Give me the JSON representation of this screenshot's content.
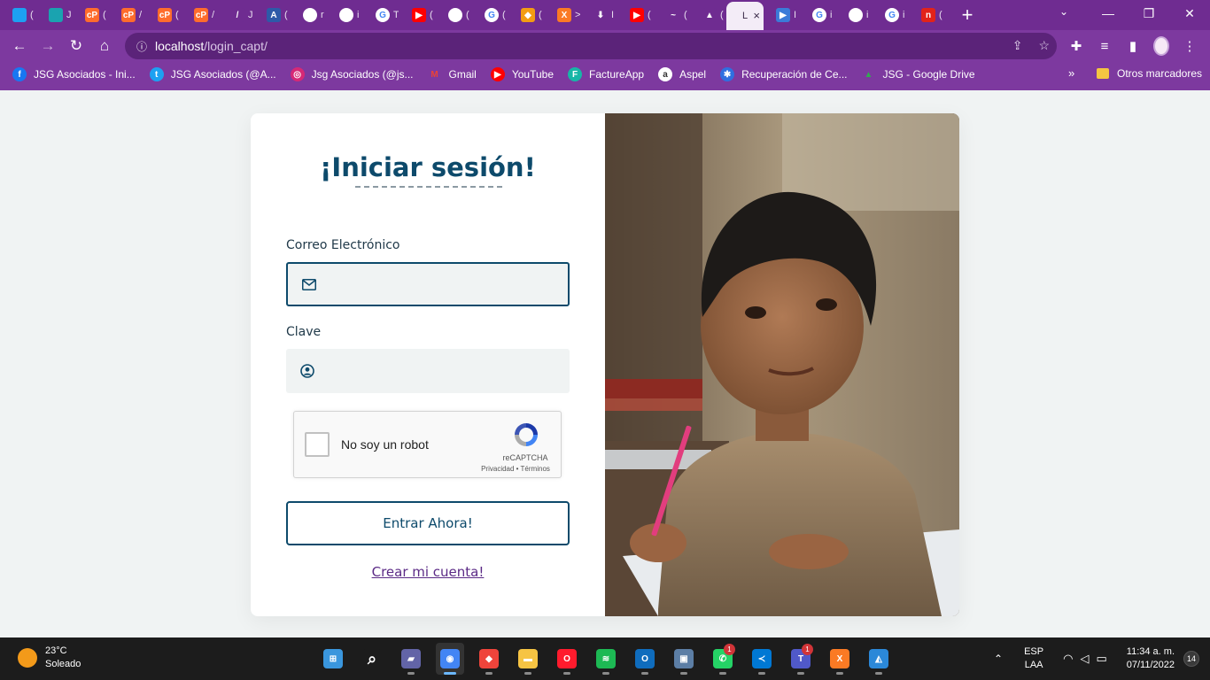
{
  "browser": {
    "tabs": [
      {
        "icon": "twitter-icon",
        "letter": "",
        "color": "#1da1f2",
        "title": "("
      },
      {
        "icon": "pulse-icon",
        "letter": "",
        "color": "#1aa3b0",
        "title": "J"
      },
      {
        "icon": "cpanel-icon",
        "letter": "cP",
        "color": "#ff6c2c",
        "title": "("
      },
      {
        "icon": "cpanel-icon",
        "letter": "cP",
        "color": "#ff6c2c",
        "title": "/"
      },
      {
        "icon": "cpanel-icon",
        "letter": "cP",
        "color": "#ff6c2c",
        "title": "("
      },
      {
        "icon": "cpanel-icon",
        "letter": "cP",
        "color": "#ff6c2c",
        "title": "/"
      },
      {
        "icon": "slash-icon",
        "letter": "/",
        "color": "#6f2c91",
        "title": "J"
      },
      {
        "icon": "document-icon",
        "letter": "A",
        "color": "#2d5aa8",
        "title": "("
      },
      {
        "icon": "globe-icon",
        "letter": "",
        "color": "#ffffff",
        "title": "r"
      },
      {
        "icon": "globe-icon",
        "letter": "",
        "color": "#ffffff",
        "title": "i"
      },
      {
        "icon": "google-icon",
        "letter": "G",
        "color": "#ffffff",
        "title": "T"
      },
      {
        "icon": "youtube-icon",
        "letter": "▶",
        "color": "#ff0000",
        "title": "("
      },
      {
        "icon": "github-icon",
        "letter": "",
        "color": "#ffffff",
        "title": "("
      },
      {
        "icon": "google-icon",
        "letter": "G",
        "color": "#ffffff",
        "title": "("
      },
      {
        "icon": "diamond-icon",
        "letter": "◆",
        "color": "#f39c12",
        "title": "("
      },
      {
        "icon": "xampp-icon",
        "letter": "X",
        "color": "#fb7a24",
        "title": ">"
      },
      {
        "icon": "download-icon",
        "letter": "⬇",
        "color": "#6f2c91",
        "title": "I"
      },
      {
        "icon": "youtube-icon",
        "letter": "▶",
        "color": "#ff0000",
        "title": "("
      },
      {
        "icon": "swoosh-icon",
        "letter": "~",
        "color": "#6f2c91",
        "title": "("
      },
      {
        "icon": "logo-icon",
        "letter": "▲",
        "color": "#6f2c91",
        "title": "("
      }
    ],
    "active_tab": {
      "title": "L",
      "close": "×"
    },
    "tabs_after": [
      {
        "icon": "app-icon",
        "letter": "▶",
        "color": "#3b7bd8",
        "title": "I"
      },
      {
        "icon": "google-icon",
        "letter": "G",
        "color": "#ffffff",
        "title": "i"
      },
      {
        "icon": "globe-icon",
        "letter": "",
        "color": "#ffffff",
        "title": "i"
      },
      {
        "icon": "google-icon",
        "letter": "G",
        "color": "#ffffff",
        "title": "i"
      },
      {
        "icon": "red-app-icon",
        "letter": "n",
        "color": "#e2231a",
        "title": "("
      }
    ],
    "new_tab": "+",
    "window_controls": {
      "tab_search": "⌄",
      "minimize": "—",
      "restore": "❐",
      "close": "✕"
    },
    "url": {
      "host": "localhost",
      "path": "/login_capt/"
    },
    "bookmarks": [
      {
        "icon": "facebook-icon",
        "letter": "f",
        "color": "#1877f2",
        "label": "JSG Asociados - Ini..."
      },
      {
        "icon": "twitter-icon",
        "letter": "t",
        "color": "#1da1f2",
        "label": "JSG Asociados (@A..."
      },
      {
        "icon": "instagram-icon",
        "letter": "◎",
        "color": "#d62976",
        "label": "Jsg Asociados (@js..."
      },
      {
        "icon": "gmail-icon",
        "letter": "M",
        "color": "#ea4335",
        "label": "Gmail"
      },
      {
        "icon": "youtube-icon",
        "letter": "▶",
        "color": "#ff0000",
        "label": "YouTube"
      },
      {
        "icon": "factureapp-icon",
        "letter": "F",
        "color": "#17b6a7",
        "label": "FactureApp"
      },
      {
        "icon": "aspel-icon",
        "letter": "a",
        "color": "#ffffff",
        "label": "Aspel"
      },
      {
        "icon": "recovery-icon",
        "letter": "✱",
        "color": "#2f6fe0",
        "label": "Recuperación de Ce..."
      },
      {
        "icon": "google-drive-icon",
        "letter": "▲",
        "color": "#34a853",
        "label": "JSG - Google Drive"
      }
    ],
    "bookmarks_more": "»",
    "other_bookmarks": "Otros marcadores"
  },
  "login": {
    "title": "¡Iniciar sesión!",
    "email_label": "Correo Electrónico",
    "email_value": "",
    "email_placeholder": "",
    "password_label": "Clave",
    "password_value": "",
    "password_placeholder": "",
    "captcha": {
      "label": "No soy un robot",
      "brand": "reCAPTCHA",
      "links": "Privacidad • Términos"
    },
    "submit_label": "Entrar Ahora!",
    "create_account_label": "Crear mi cuenta!"
  },
  "colors": {
    "primary": "#0d4a6b",
    "accent_purple": "#6f2c91",
    "link_purple": "#5b2a86",
    "input_bg": "#f0f3f3"
  },
  "taskbar": {
    "weather": {
      "temp": "23°C",
      "condition": "Soleado"
    },
    "apps": [
      {
        "name": "windows-start-icon",
        "color": "#3a96dd",
        "letter": "⊞",
        "badge": ""
      },
      {
        "name": "search-icon",
        "color": "#1c1c1c",
        "letter": "⌕",
        "badge": ""
      },
      {
        "name": "meet-icon",
        "color": "#6264a7",
        "letter": "▰",
        "badge": ""
      },
      {
        "name": "chrome-icon",
        "color": "#4285f4",
        "letter": "◉",
        "badge": "",
        "active": true
      },
      {
        "name": "anydesk-icon",
        "color": "#ef443b",
        "letter": "◆",
        "badge": ""
      },
      {
        "name": "file-explorer-icon",
        "color": "#f6c443",
        "letter": "▬",
        "badge": ""
      },
      {
        "name": "opera-icon",
        "color": "#ff1b2d",
        "letter": "O",
        "badge": ""
      },
      {
        "name": "spotify-icon",
        "color": "#1db954",
        "letter": "≋",
        "badge": ""
      },
      {
        "name": "outlook-icon",
        "color": "#0f6cbd",
        "letter": "O",
        "badge": ""
      },
      {
        "name": "remote-desktop-icon",
        "color": "#5c7ea5",
        "letter": "▣",
        "badge": ""
      },
      {
        "name": "whatsapp-icon",
        "color": "#25d366",
        "letter": "✆",
        "badge": "1"
      },
      {
        "name": "vscode-icon",
        "color": "#0078d4",
        "letter": "≺",
        "badge": ""
      },
      {
        "name": "teams-icon",
        "color": "#5059c9",
        "letter": "T",
        "badge": "1"
      },
      {
        "name": "xampp-icon",
        "color": "#fb7a24",
        "letter": "X",
        "badge": ""
      },
      {
        "name": "photos-icon",
        "color": "#2b88d8",
        "letter": "◭",
        "badge": ""
      }
    ],
    "tray": {
      "chevron": "⌃",
      "lang_top": "ESP",
      "lang_bottom": "LAA",
      "time": "11:34 a. m.",
      "date": "07/11/2022",
      "notifications": "14"
    }
  }
}
